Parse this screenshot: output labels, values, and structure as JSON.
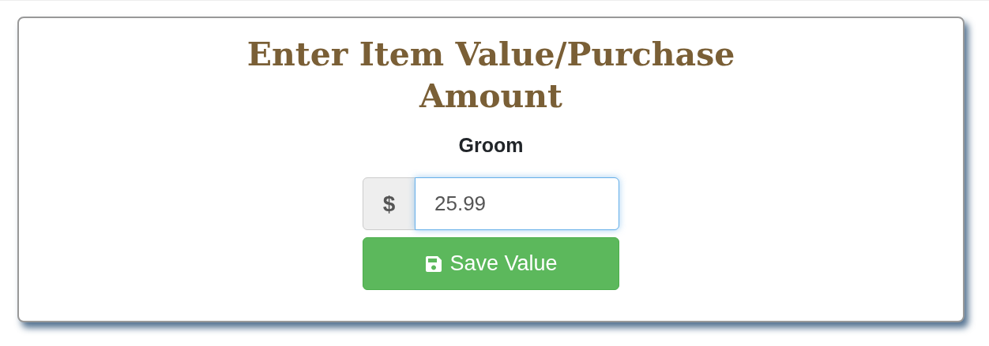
{
  "dialog": {
    "title": "Enter Item Value/Purchase Amount",
    "subtitle": "Groom",
    "amount_field": {
      "prefix": "$",
      "value": "25.99",
      "focused": true
    },
    "save_button": {
      "label": "Save Value"
    }
  }
}
